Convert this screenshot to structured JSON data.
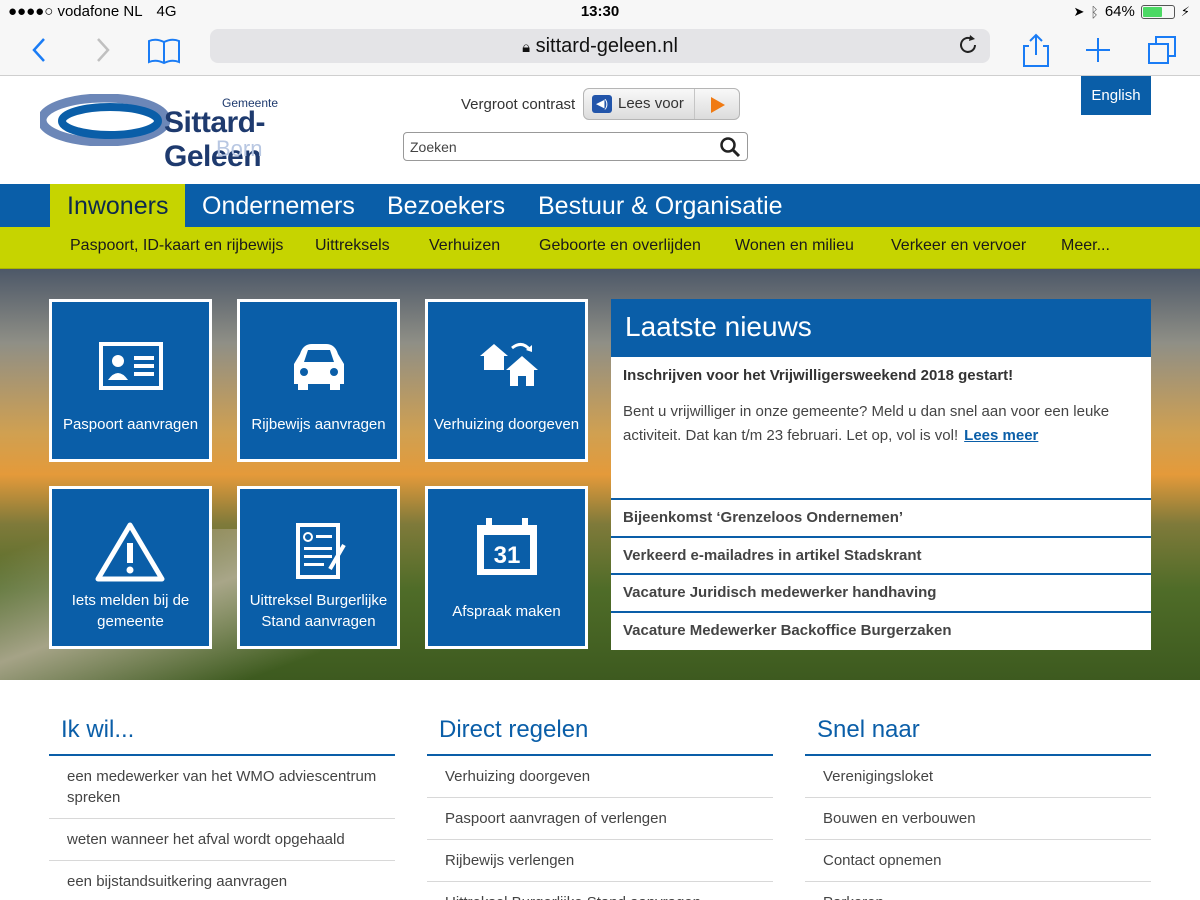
{
  "status_bar": {
    "carrier": "●●●●○ vodafone NL",
    "network": "4G",
    "time": "13:30",
    "battery": "64%",
    "battery_level": 0.64
  },
  "browser": {
    "url": "sittard-geleen.nl",
    "icons": [
      "back-icon",
      "forward-icon",
      "bookmarks-icon",
      "lock-icon",
      "reload-icon",
      "share-icon",
      "new-tab-icon",
      "tabs-icon"
    ]
  },
  "header": {
    "logo": {
      "gemeente": "Gemeente",
      "name": "Sittard-Geleen",
      "born": "Born"
    },
    "contrast_label": "Vergroot contrast",
    "lees_voor_label": "Lees voor",
    "search_placeholder": "Zoeken",
    "language_button": "English"
  },
  "main_nav": [
    {
      "label": "Inwoners",
      "active": true
    },
    {
      "label": "Ondernemers",
      "active": false
    },
    {
      "label": "Bezoekers",
      "active": false
    },
    {
      "label": "Bestuur & Organisatie",
      "active": false
    }
  ],
  "sub_nav": [
    "Paspoort, ID-kaart en rijbewijs",
    "Uittreksels",
    "Verhuizen",
    "Geboorte en overlijden",
    "Wonen en milieu",
    "Verkeer en vervoer",
    "Meer..."
  ],
  "tiles": [
    {
      "label": "Paspoort aanvragen",
      "icon": "id-card-icon"
    },
    {
      "label": "Rijbewijs aanvragen",
      "icon": "car-icon"
    },
    {
      "label": "Verhuizing doorgeven",
      "icon": "moving-houses-icon"
    },
    {
      "label": "Iets melden bij de gemeente",
      "icon": "warning-icon"
    },
    {
      "label": "Uittreksel Burgerlijke Stand aanvragen",
      "icon": "certificate-icon"
    },
    {
      "label": "Afspraak maken",
      "icon": "calendar-icon",
      "calendar_day": "31"
    }
  ],
  "news": {
    "title": "Laatste nieuws",
    "featured": {
      "title": "Inschrijven voor het Vrijwilligersweekend 2018 gestart!",
      "body": "Bent u vrijwilliger in onze gemeente? Meld u dan snel aan voor een leuke activiteit. Dat kan t/m 23 februari. Let op, vol is vol!",
      "link": "Lees meer"
    },
    "items": [
      "Bijeenkomst ‘Grenzeloos Ondernemen’",
      "Verkeerd e-mailadres in artikel Stadskrant",
      "Vacature Juridisch medewerker handhaving",
      "Vacature Medewerker Backoffice Burgerzaken"
    ]
  },
  "columns": [
    {
      "title": "Ik wil...",
      "links": [
        "een medewerker van het WMO adviescentrum spreken",
        "weten wanneer het afval wordt opgehaald",
        "een bijstandsuitkering aanvragen"
      ]
    },
    {
      "title": "Direct regelen",
      "links": [
        "Verhuizing doorgeven",
        "Paspoort aanvragen of verlengen",
        "Rijbewijs verlengen",
        "Uittreksel Burgerlijke Stand aanvragen"
      ]
    },
    {
      "title": "Snel naar",
      "links": [
        "Verenigingsloket",
        "Bouwen en verbouwen",
        "Contact opnemen",
        "Parkeren"
      ]
    }
  ],
  "colors": {
    "brand_blue": "#0a5ea8",
    "accent_green": "#c6d400",
    "ios_blue": "#1a7cf5"
  }
}
